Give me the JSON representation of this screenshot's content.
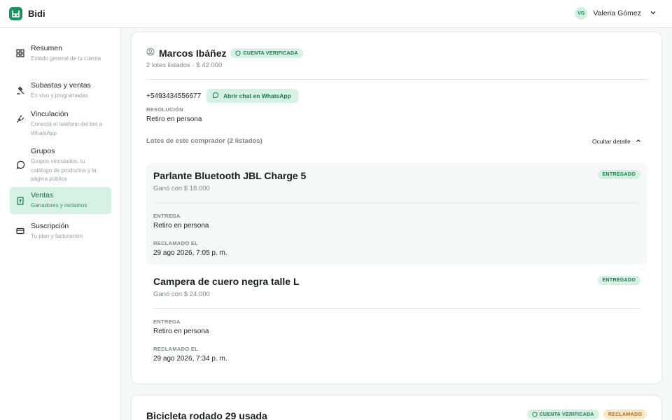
{
  "app": {
    "name": "Bidi"
  },
  "user": {
    "initials": "VG",
    "name": "Valeria Gómez"
  },
  "sidebar": {
    "items": [
      {
        "label": "Resumen",
        "sub": "Estado general de tu cuenta",
        "icon": "dashboard-icon",
        "active": false
      },
      {
        "label": "Subastas y ventas",
        "sub": "En vivo y programadas",
        "icon": "gavel-icon",
        "active": false
      },
      {
        "label": "Vinculación",
        "sub": "Conectá el teléfono del bot a WhatsApp",
        "icon": "plug-icon",
        "active": false
      },
      {
        "label": "Grupos",
        "sub": "Grupos vinculados, tu catálogo de productos y la página pública",
        "icon": "whatsapp-icon",
        "active": false
      },
      {
        "label": "Ventas",
        "sub": "Ganadores y reclamos",
        "icon": "receipt-icon",
        "active": true
      },
      {
        "label": "Suscripción",
        "sub": "Tu plan y facturación",
        "icon": "credit-card-icon",
        "active": false
      }
    ]
  },
  "buyer": {
    "name": "Marcos Ibáñez",
    "verified_label": "CUENTA VERIFICADA",
    "meta": "2 lotes listados · $ 42.000",
    "phone": "+5493434556677",
    "whatsapp_label": "Abrir chat en WhatsApp",
    "resolution_label": "RESOLUCIÓN",
    "resolution_value": "Retiro en persona",
    "lots_label": "Lotes de este comprador (2 listados)",
    "toggle_label": "Ocultar detalle"
  },
  "lots": [
    {
      "title": "Parlante Bluetooth JBL Charge 5",
      "won": "Ganó con $ 18.000",
      "status": "ENTREGADO",
      "delivery_label": "ENTREGA",
      "delivery_value": "Retiro en persona",
      "claimed_label": "RECLAMADO EL",
      "claimed_value": "29 ago 2026, 7:05 p. m."
    },
    {
      "title": "Campera de cuero negra talle L",
      "won": "Ganó con $ 24.000",
      "status": "ENTREGADO",
      "delivery_label": "ENTREGA",
      "delivery_value": "Retiro en persona",
      "claimed_label": "RECLAMADO EL",
      "claimed_value": "29 ago 2026, 7:34 p. m."
    }
  ],
  "next_card": {
    "title": "Bicicleta rodado 29 usada",
    "verified_label": "CUENTA VERIFICADA",
    "status": "RECLAMADO"
  },
  "colors": {
    "accent": "#1d8f62",
    "accent_soft": "#d5f1e3",
    "warning_soft": "#fde8c6"
  }
}
